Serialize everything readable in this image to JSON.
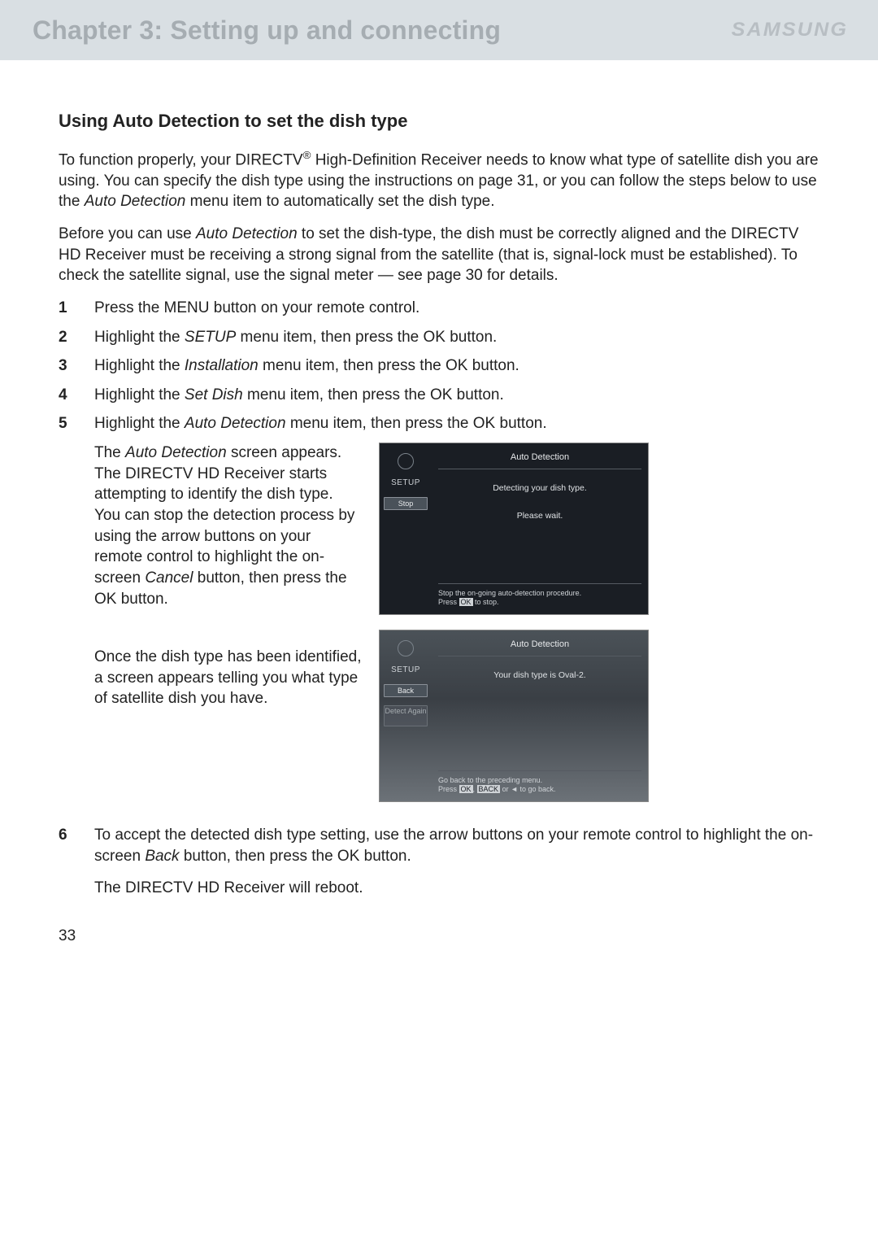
{
  "header": {
    "chapter_title": "Chapter 3: Setting up and connecting",
    "brand": "SAMSUNG"
  },
  "section": {
    "title": "Using Auto Detection to set the dish type",
    "intro_parts": {
      "a": "To function properly, your DIRECTV",
      "reg": "®",
      "b": " High-Definition Receiver needs to know what type of satellite dish you are using. You can specify the dish type using the instructions on page 31, or you can follow the steps below to use the ",
      "c_ital": "Auto Detection",
      "d": " menu item to automatically set the dish type."
    },
    "prereq_parts": {
      "a": "Before you can use ",
      "b_ital": "Auto Detection",
      "c": " to set the dish-type, the dish must be correctly aligned and the DIRECTV HD Receiver must be receiving a strong signal from the satellite (that is, signal-lock must be established). To check the satellite signal, use the signal meter — see page 30 for details."
    },
    "steps": [
      {
        "n": "1",
        "text": "Press the MENU button on your remote control."
      },
      {
        "n": "2",
        "pre": "Highlight the ",
        "ital": "SETUP",
        "post": " menu item, then press the OK button."
      },
      {
        "n": "3",
        "pre": "Highlight the ",
        "ital": "Installation",
        "post": " menu item, then press the OK button."
      },
      {
        "n": "4",
        "pre": "Highlight the ",
        "ital": "Set Dish",
        "post": " menu item, then press the OK button."
      },
      {
        "n": "5",
        "pre": "Highlight the ",
        "ital": "Auto Detection",
        "post": " menu item, then press the OK button."
      }
    ],
    "sub5_parts": {
      "a": "The ",
      "b_ital": "Auto Detection",
      "c": " screen appears. The DIRECTV HD Receiver starts attempting to identify the dish type. You can stop the detection process by using the arrow buttons on your remote control to highlight the on-screen ",
      "d_ital": "Cancel",
      "e": " button, then press the OK button."
    },
    "sub5b": "Once the dish type has been identified, a screen appears telling you what type of satellite dish you have.",
    "step6": {
      "n": "6"
    },
    "step6_parts": {
      "a": "To accept the detected dish type setting, use the arrow buttons on your remote control to highlight the on-screen ",
      "b_ital": "Back",
      "c": " button, then press the OK button."
    },
    "step6_after": "The DIRECTV HD Receiver will reboot."
  },
  "tv1": {
    "side_label": "SETUP",
    "btn_stop": "Stop",
    "title": "Auto Detection",
    "line1": "Detecting your dish type.",
    "line2": "Please wait.",
    "footer_a": "Stop the on-going auto-detection procedure.",
    "footer_b_pre": "Press ",
    "footer_b_ok": "OK",
    "footer_b_post": " to stop."
  },
  "tv2": {
    "side_label": "SETUP",
    "btn_back": "Back",
    "btn_detect": "Detect Again",
    "title": "Auto Detection",
    "line1": "Your dish type is Oval-2.",
    "footer_a": "Go back to the preceding menu.",
    "footer_b_pre": "Press ",
    "footer_b_ok": "OK",
    "footer_b_mid": ", ",
    "footer_b_back": "BACK",
    "footer_b_post": " or ◄ to go back."
  },
  "page_number": "33"
}
